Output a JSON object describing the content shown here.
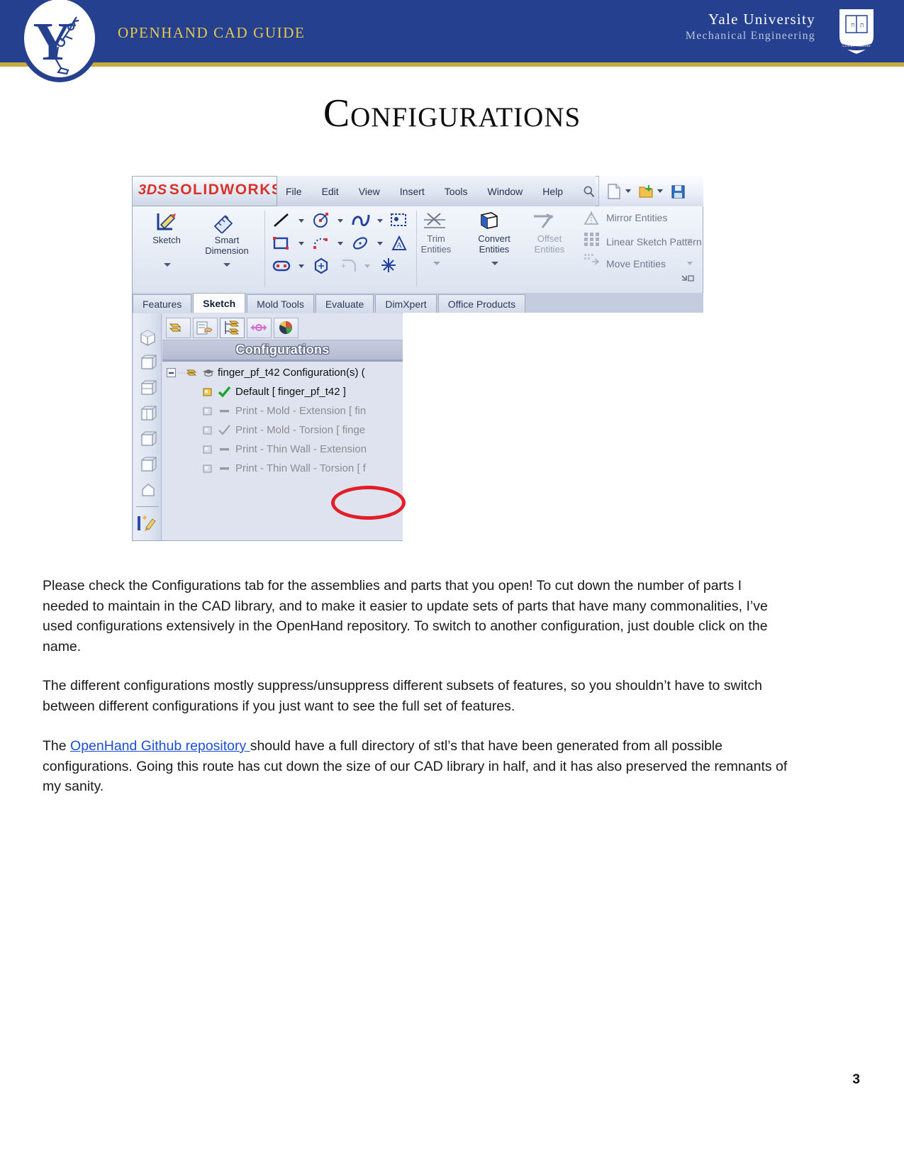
{
  "header": {
    "guide_title": "OpenHand CAD Guide",
    "university": "Yale University",
    "department": "Mechanical Engineering",
    "band_color": "#25408f",
    "gold_color": "#c8a93b",
    "title_color": "#e8c84a"
  },
  "page": {
    "title": "Configurations",
    "number": "3"
  },
  "solidworks": {
    "brand_ds": "3DS",
    "brand_name": "SOLIDWORKS",
    "menus": [
      "File",
      "Edit",
      "View",
      "Insert",
      "Tools",
      "Window",
      "Help"
    ],
    "ribbon_buttons": [
      {
        "label_line1": "Sketch",
        "label_line2": ""
      },
      {
        "label_line1": "Smart",
        "label_line2": "Dimension"
      },
      {
        "label_line1": "Trim",
        "label_line2": "Entities"
      },
      {
        "label_line1": "Convert",
        "label_line2": "Entities"
      },
      {
        "label_line1": "Offset",
        "label_line2": "Entities"
      }
    ],
    "ribbon_list": [
      "Mirror Entities",
      "Linear Sketch Pattern",
      "Move Entities"
    ],
    "tabs": [
      {
        "label": "Features",
        "active": false
      },
      {
        "label": "Sketch",
        "active": true
      },
      {
        "label": "Mold Tools",
        "active": false
      },
      {
        "label": "Evaluate",
        "active": false
      },
      {
        "label": "DimXpert",
        "active": false
      },
      {
        "label": "Office Products",
        "active": false
      }
    ],
    "panel_title": "Configurations",
    "tree_root": "finger_pf_t42 Configuration(s)  (",
    "tree_items": [
      {
        "label": "Default [ finger_pf_t42 ]",
        "state": "active",
        "mark": "check-green"
      },
      {
        "label": "Print - Mold - Extension [ fin",
        "state": "inactive",
        "mark": "dash"
      },
      {
        "label": "Print - Mold - Torsion [ finge",
        "state": "inactive",
        "mark": "check-grey"
      },
      {
        "label": "Print - Thin Wall - Extension",
        "state": "inactive",
        "mark": "dash"
      },
      {
        "label": "Print - Thin Wall - Torsion [ f",
        "state": "inactive",
        "mark": "dash"
      }
    ],
    "highlight_color": "#e21f26"
  },
  "body": {
    "paragraph1": "Please check the Configurations tab for the assemblies and parts that you open! To cut down the number of parts I needed to maintain in the CAD library, and to make it easier to update sets of parts that have many commonalities, I’ve used configurations extensively in the OpenHand repository. To switch to another configuration, just double click on the name.",
    "paragraph2": "The different configurations mostly suppress/unsuppress different subsets of features, so you shouldn’t have to switch between different configurations if you just want to see the full set of features.",
    "paragraph3_pre": "The ",
    "paragraph3_link": "OpenHand Github repository ",
    "paragraph3_post": "should have a full directory of stl’s that have been generated from all possible configurations. Going this route has cut down the size of our CAD library in half, and it has also preserved the remnants of my sanity."
  }
}
